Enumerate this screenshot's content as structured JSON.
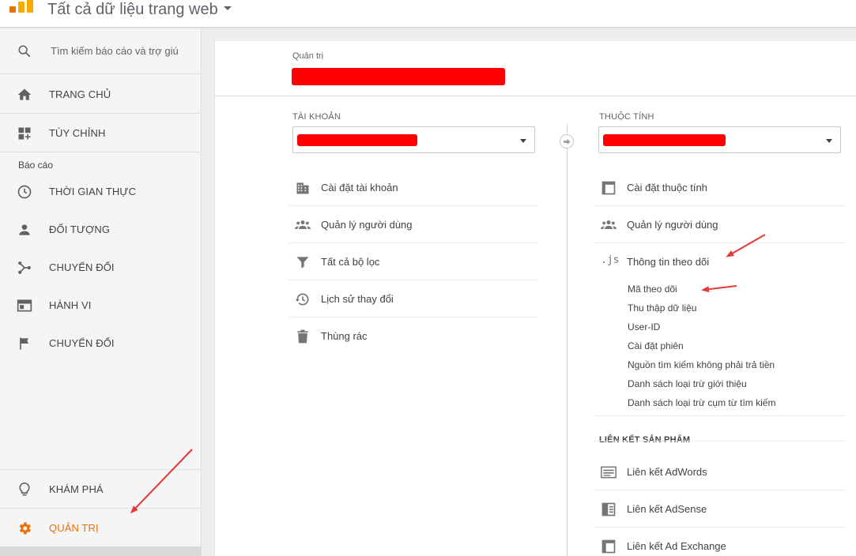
{
  "header": {
    "view_title": "Tất cả dữ liệu trang web"
  },
  "sidebar": {
    "search_placeholder": "Tìm kiếm báo cáo và trợ giú",
    "home": "TRANG CHỦ",
    "customize": "TÙY CHỈNH",
    "reports_label": "Báo cáo",
    "reports": [
      {
        "label": "THỜI GIAN THỰC",
        "icon": "clock-icon"
      },
      {
        "label": "ĐỐI TƯỢNG",
        "icon": "person-icon"
      },
      {
        "label": "CHUYỂN ĐỔI",
        "icon": "acquisition-icon"
      },
      {
        "label": "HÀNH VI",
        "icon": "behavior-icon"
      },
      {
        "label": "CHUYỂN ĐỔI",
        "icon": "flag-icon"
      }
    ],
    "discover": "KHÁM PHÁ",
    "admin": "QUẢN TRỊ"
  },
  "admin": {
    "breadcrumb": "Quản trị",
    "account_column": {
      "label": "TÀI KHOẢN",
      "items": [
        {
          "label": "Cài đặt tài khoản",
          "icon": "building-icon"
        },
        {
          "label": "Quản lý người dùng",
          "icon": "users-icon"
        },
        {
          "label": "Tất cả bộ lọc",
          "icon": "filter-icon"
        },
        {
          "label": "Lịch sử thay đổi",
          "icon": "history-icon"
        },
        {
          "label": "Thùng rác",
          "icon": "trash-icon"
        }
      ]
    },
    "property_column": {
      "label": "THUỘC TÍNH",
      "items": [
        {
          "label": "Cài đặt thuộc tính",
          "icon": "property-settings-icon"
        },
        {
          "label": "Quản lý người dùng",
          "icon": "users-icon"
        },
        {
          "label": "Thông tin theo dõi",
          "icon": "js-icon",
          "icon_text": ".js"
        }
      ],
      "tracking_subitems": [
        "Mã theo dõi",
        "Thu thập dữ liệu",
        "User-ID",
        "Cài đặt phiên",
        "Nguồn tìm kiếm không phải trả tiền",
        "Danh sách loại trừ giới thiệu",
        "Danh sách loại trừ cụm từ tìm kiếm"
      ],
      "product_links_header": "LIÊN KẾT SẢN PHẨM",
      "product_links": [
        {
          "label": "Liên kết AdWords",
          "icon": "adwords-icon"
        },
        {
          "label": "Liên kết AdSense",
          "icon": "adsense-icon"
        },
        {
          "label": "Liên kết Ad Exchange",
          "icon": "ad-exchange-icon"
        }
      ]
    }
  },
  "colors": {
    "accent": "#e8710a",
    "annotation_arrow": "#e53935",
    "redaction": "#ff0000"
  }
}
